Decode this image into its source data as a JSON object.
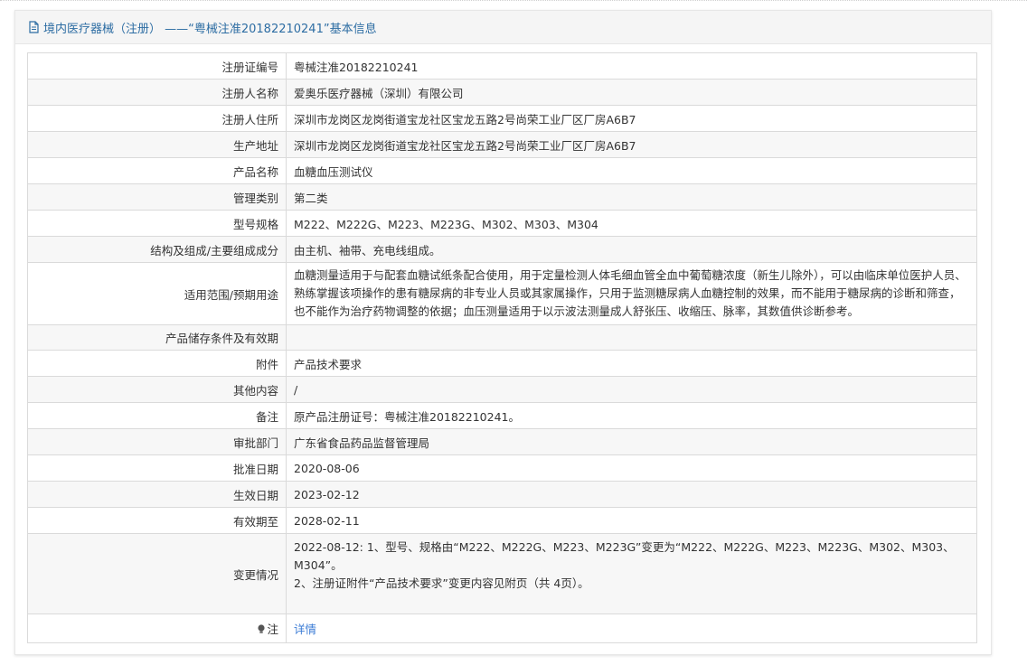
{
  "header": {
    "title": "境内医疗器械（注册） ——“粤械注准20182210241”基本信息"
  },
  "rows": [
    {
      "label": "注册证编号",
      "value": "粤械注准20182210241"
    },
    {
      "label": "注册人名称",
      "value": "爱奥乐医疗器械（深圳）有限公司"
    },
    {
      "label": "注册人住所",
      "value": "深圳市龙岗区龙岗街道宝龙社区宝龙五路2号尚荣工业厂区厂房A6B7"
    },
    {
      "label": "生产地址",
      "value": "深圳市龙岗区龙岗街道宝龙社区宝龙五路2号尚荣工业厂区厂房A6B7"
    },
    {
      "label": "产品名称",
      "value": "血糖血压测试仪"
    },
    {
      "label": "管理类别",
      "value": "第二类"
    },
    {
      "label": "型号规格",
      "value": "M222、M222G、M223、M223G、M302、M303、M304"
    },
    {
      "label": "结构及组成/主要组成成分",
      "value": "由主机、袖带、充电线组成。"
    },
    {
      "label": "适用范围/预期用途",
      "value": "血糖测量适用于与配套血糖试纸条配合使用，用于定量检测人体毛细血管全血中葡萄糖浓度（新生儿除外），可以由临床单位医护人员、熟练掌握该项操作的患有糖尿病的非专业人员或其家属操作，只用于监测糖尿病人血糖控制的效果，而不能用于糖尿病的诊断和筛查，也不能作为治疗药物调整的依据；血压测量适用于以示波法测量成人舒张压、收缩压、脉率，其数值供诊断参考。"
    },
    {
      "label": "产品储存条件及有效期",
      "value": ""
    },
    {
      "label": "附件",
      "value": "产品技术要求"
    },
    {
      "label": "其他内容",
      "value": "/"
    },
    {
      "label": "备注",
      "value": "原产品注册证号：粤械注准20182210241。"
    },
    {
      "label": "审批部门",
      "value": "广东省食品药品监督管理局"
    },
    {
      "label": "批准日期",
      "value": "2020-08-06"
    },
    {
      "label": "生效日期",
      "value": "2023-02-12"
    },
    {
      "label": "有效期至",
      "value": "2028-02-11"
    }
  ],
  "change": {
    "label": "变更情况",
    "line1": "2022-08-12: 1、型号、规格由“M222、M222G、M223、M223G”变更为“M222、M222G、M223、M223G、M302、M303、M304”。",
    "line2": "2、注册证附件“产品技术要求”变更内容见附页（共 4页）。"
  },
  "note": {
    "label": "注",
    "icon": "lightbulb-icon",
    "link": "详情",
    "link_color": "#3a7bd5"
  },
  "colors": {
    "header_text": "#2d6da3",
    "row_even_bg": "#f7f7f7",
    "border": "#dadada"
  }
}
